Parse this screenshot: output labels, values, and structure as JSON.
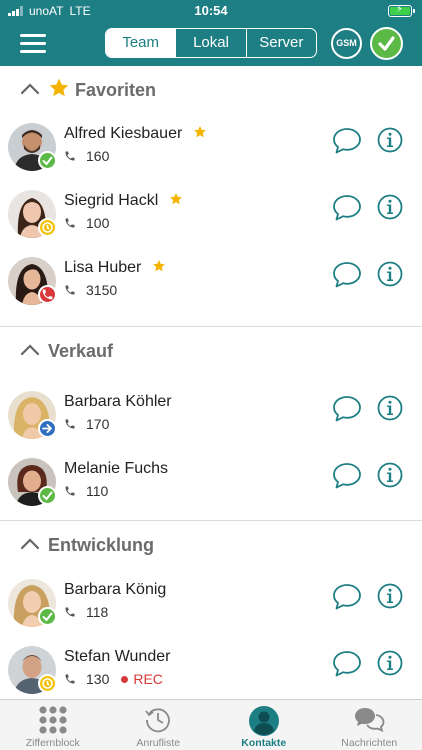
{
  "status_bar": {
    "carrier": "unoAT",
    "network": "LTE",
    "time": "10:54"
  },
  "header": {
    "tabs": [
      {
        "label": "Team",
        "active": true
      },
      {
        "label": "Lokal",
        "active": false
      },
      {
        "label": "Server",
        "active": false
      }
    ],
    "gsm_label": "GSM",
    "accent_color": "#1d7e83"
  },
  "sections": [
    {
      "title": "Favoriten",
      "icon": "star-icon",
      "contacts": [
        {
          "name": "Alfred Kiesbauer",
          "ext": "160",
          "favorite": true,
          "status": "available"
        },
        {
          "name": "Siegrid Hackl",
          "ext": "100",
          "favorite": true,
          "status": "away"
        },
        {
          "name": "Lisa Huber",
          "ext": "3150",
          "favorite": true,
          "status": "on-call"
        }
      ]
    },
    {
      "title": "Verkauf",
      "contacts": [
        {
          "name": "Barbara Köhler",
          "ext": "170",
          "favorite": false,
          "status": "forwarded"
        },
        {
          "name": "Melanie Fuchs",
          "ext": "110",
          "favorite": false,
          "status": "available"
        }
      ]
    },
    {
      "title": "Entwicklung",
      "contacts": [
        {
          "name": "Barbara König",
          "ext": "118",
          "favorite": false,
          "status": "available"
        },
        {
          "name": "Stefan Wunder",
          "ext": "130",
          "favorite": false,
          "status": "away",
          "rec": "REC"
        }
      ]
    }
  ],
  "status_colors": {
    "available": "#5cb946",
    "away": "#f2c20c",
    "on-call": "#d9383a",
    "forwarded": "#2f6fc0"
  },
  "tabbar": [
    {
      "label": "Ziffernblock",
      "icon": "keypad-icon",
      "active": false
    },
    {
      "label": "Anrufliste",
      "icon": "history-clock-icon",
      "active": false
    },
    {
      "label": "Kontakte",
      "icon": "contact-person-icon",
      "active": true
    },
    {
      "label": "Nachrichten",
      "icon": "messages-icon",
      "active": false
    }
  ]
}
